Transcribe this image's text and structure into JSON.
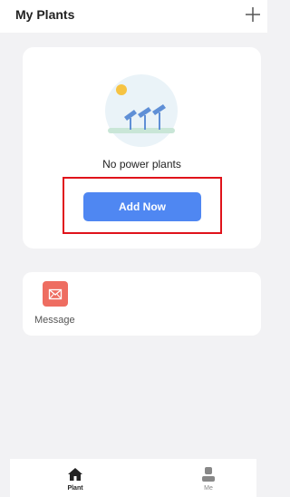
{
  "header": {
    "title": "My Plants",
    "add_icon": "plus-icon"
  },
  "plants_card": {
    "empty_text": "No power plants",
    "add_button_label": "Add Now",
    "illustration": "solar-panels-sun-illustration"
  },
  "message_card": {
    "label": "Message",
    "icon": "envelope-icon"
  },
  "tabbar": {
    "tabs": [
      {
        "label": "Plant",
        "icon": "home-icon",
        "active": true
      },
      {
        "label": "Me",
        "icon": "person-icon",
        "active": false
      }
    ]
  },
  "colors": {
    "accent": "#4f87f2",
    "message_icon_bg": "#ee6d61",
    "highlight_border": "#e0131b",
    "background": "#f2f2f4"
  }
}
